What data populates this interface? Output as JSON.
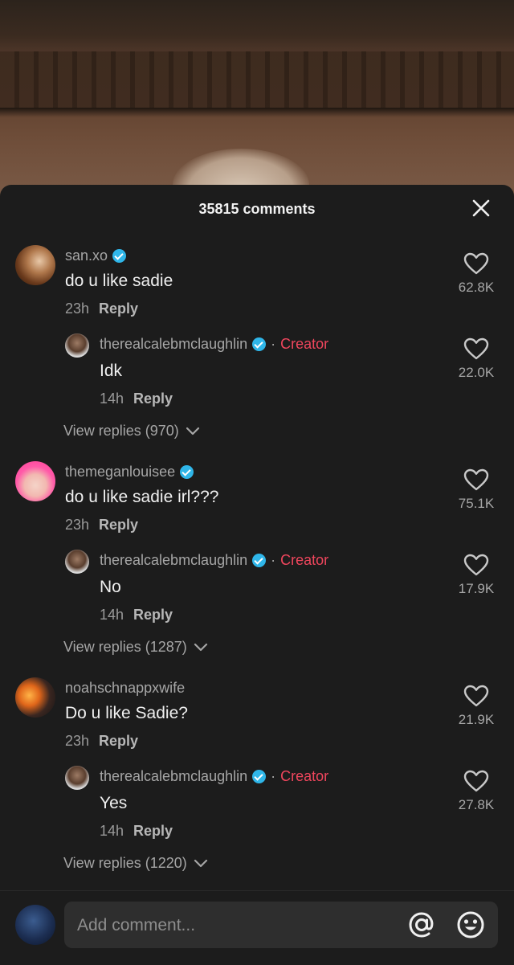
{
  "header": {
    "comment_count": "35815 comments"
  },
  "threads": [
    {
      "user": "san.xo",
      "text": "do u like sadie",
      "time": "23h",
      "reply_label": "Reply",
      "likes": "62.8K",
      "reply": {
        "user": "therealcalebmclaughlin",
        "creator_label": "Creator",
        "text": "Idk",
        "time": "14h",
        "reply_label": "Reply",
        "likes": "22.0K"
      },
      "view_replies": "View replies (970)"
    },
    {
      "user": "themeganlouisee",
      "text": "do u like sadie irl???",
      "time": "23h",
      "reply_label": "Reply",
      "likes": "75.1K",
      "reply": {
        "user": "therealcalebmclaughlin",
        "creator_label": "Creator",
        "text": "No",
        "time": "14h",
        "reply_label": "Reply",
        "likes": "17.9K"
      },
      "view_replies": "View replies (1287)"
    },
    {
      "user": "noahschnappxwife",
      "text": "Do u like Sadie?",
      "time": "23h",
      "reply_label": "Reply",
      "likes": "21.9K",
      "reply": {
        "user": "therealcalebmclaughlin",
        "creator_label": "Creator",
        "text": "Yes",
        "time": "14h",
        "reply_label": "Reply",
        "likes": "27.8K"
      },
      "view_replies": "View replies (1220)"
    }
  ],
  "footer": {
    "placeholder": "Add comment..."
  },
  "colors": {
    "creator": "#f0465d",
    "verified": "#2fb6e9",
    "sheet": "#1c1c1c"
  }
}
